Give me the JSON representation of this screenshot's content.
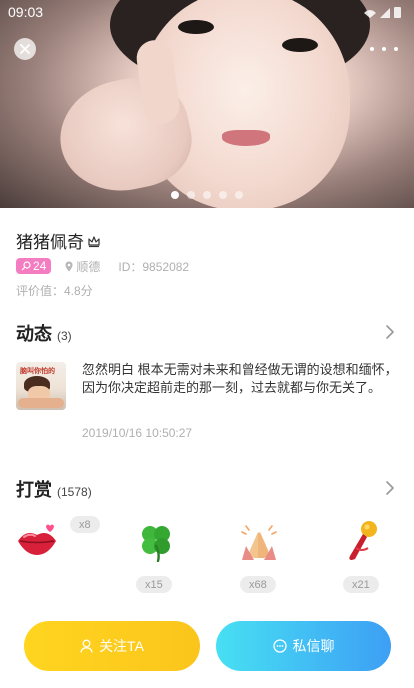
{
  "status_bar": {
    "time": "09:03"
  },
  "carousel": {
    "page_count": 5,
    "active_index": 0
  },
  "profile": {
    "name": "猪猪佩奇",
    "age": "24",
    "location": "顺德",
    "id_text": "ID：9852082",
    "rating_text": "评价值：4.8分"
  },
  "moments": {
    "title": "动态",
    "count": "(3)",
    "post": {
      "thumb_caption": "脑叫你怕的",
      "text": "忽然明白 根本无需对未来和曾经做无谓的设想和缅怀，因为你决定超前走的那一刻，过去就都与你无关了。",
      "time": "2019/10/16 10:50:27"
    }
  },
  "rewards": {
    "title": "打赏",
    "count": "(1578)",
    "gifts": [
      {
        "icon": "lips-icon",
        "count": "x8"
      },
      {
        "icon": "clover-icon",
        "count": "x15"
      },
      {
        "icon": "praying-hands-icon",
        "count": "x68"
      },
      {
        "icon": "microphone-icon",
        "count": "x21"
      }
    ]
  },
  "actions": {
    "follow_label": "关注TA",
    "chat_label": "私信聊"
  },
  "colors": {
    "age_badge": "#f47cc0",
    "follow_button": "#ffd51f",
    "chat_button": "#3d9ff4"
  }
}
